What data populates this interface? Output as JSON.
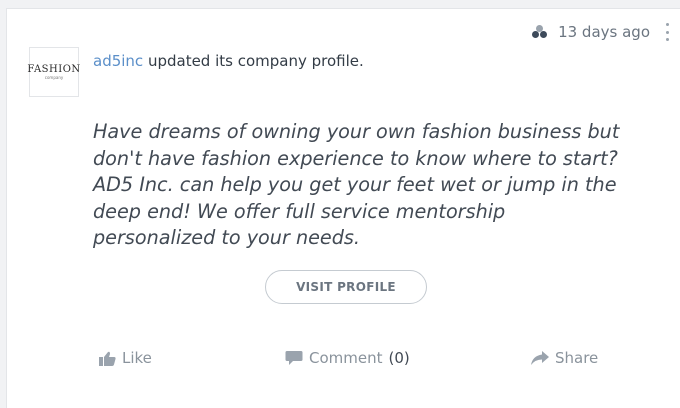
{
  "post": {
    "timestamp": "13 days ago",
    "company_link": "ad5inc",
    "headline_rest": " updated its company profile.",
    "body": "Have dreams of owning your own fashion business but don't have fashion experience to know where to start? AD5 Inc. can help you get your feet wet or jump in the deep end! We offer full service mentorship personalized to your needs.",
    "visit_label": "VISIT PROFILE"
  },
  "logo": {
    "word": "FASHION",
    "sub": "company"
  },
  "actions": {
    "like": "Like",
    "comment": "Comment",
    "comment_count": "(0)",
    "share": "Share"
  },
  "colors": {
    "link": "#5b8fc9",
    "muted": "#8a939c",
    "text": "#424a54"
  },
  "icons": [
    "people-icon",
    "kebab-menu-icon",
    "thumbs-up-icon",
    "comment-icon",
    "share-arrow-icon"
  ]
}
